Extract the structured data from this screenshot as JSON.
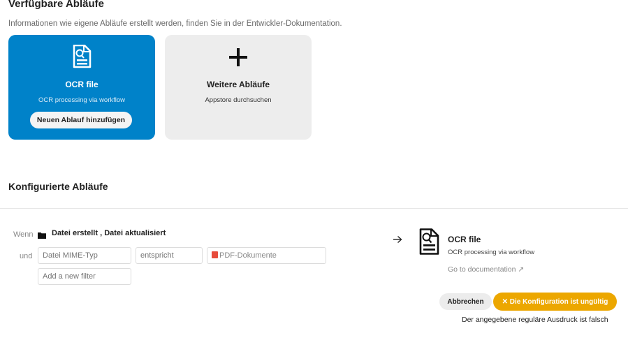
{
  "available": {
    "title": "Verfügbare Abläufe",
    "subtitle": "Informationen wie eigene Abläufe erstellt werden, finden Sie in der Entwickler-Dokumentation.",
    "cards": [
      {
        "icon": "document-search-icon",
        "title": "OCR file",
        "description": "OCR processing via workflow",
        "button_label": "Neuen Ablauf hinzufügen",
        "color": "#0082c9"
      },
      {
        "icon": "plus-icon",
        "title": "Weitere Abläufe",
        "description": "Appstore durchsuchen",
        "color": "#ededed"
      }
    ]
  },
  "configured": {
    "title": "Konfigurierte Abläufe",
    "when_label": "Wenn",
    "events_text": "Datei erstellt ,  Datei aktualisiert",
    "and_label": "und",
    "filter": {
      "type_placeholder": "Datei MIME-Typ",
      "operator_placeholder": "entspricht",
      "value_placeholder": "PDF-Dokumente",
      "value_icon": "pdf-icon"
    },
    "add_filter_placeholder": "Add a new filter",
    "operation": {
      "icon": "document-search-icon",
      "title": "OCR file",
      "description": "OCR processing via workflow",
      "doc_link": "Go to documentation ↗"
    },
    "cancel_label": "Abbrechen",
    "invalid_label": "✕  Die Konfiguration ist ungültig",
    "invalid_color": "#eca700",
    "error_text": "Der angegebene reguläre Ausdruck ist falsch"
  }
}
